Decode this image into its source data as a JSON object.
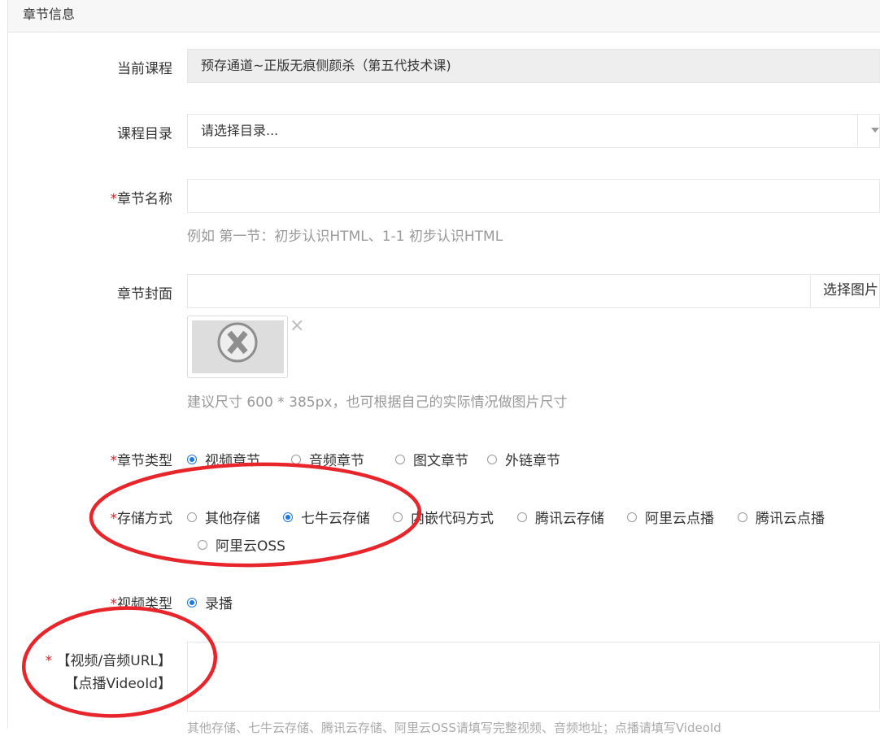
{
  "panel": {
    "title": "章节信息"
  },
  "form": {
    "current_course": {
      "label": "当前课程",
      "value": "预存通道~正版无痕侧颜杀（第五代技术课)"
    },
    "catalog": {
      "label": "课程目录",
      "value": "请选择目录..."
    },
    "chapter_name": {
      "required": "*",
      "label": "章节名称",
      "value": "",
      "help": "例如 第一节：初步认识HTML、1-1 初步认识HTML"
    },
    "cover": {
      "label": "章节封面",
      "value": "",
      "button": "选择图片",
      "remove": "×",
      "help": "建议尺寸 600 * 385px，也可根据自己的实际情况做图片尺寸"
    },
    "chapter_type": {
      "required": "*",
      "label": "章节类型",
      "options": [
        "视频章节",
        "音频章节",
        "图文章节",
        "外链章节"
      ],
      "selected": "视频章节"
    },
    "storage": {
      "required": "*",
      "label": "存储方式",
      "options": [
        "其他存储",
        "七牛云存储",
        "内嵌代码方式",
        "腾讯云存储",
        "阿里云点播",
        "腾讯云点播",
        "阿里云OSS"
      ],
      "selected": "七牛云存储"
    },
    "video_type": {
      "required": "*",
      "label": "视频类型",
      "options": [
        "录播"
      ],
      "selected": "录播"
    },
    "video_url": {
      "required": "*",
      "label_line1": "【视频/音频URL】",
      "label_line2": "【点播VideoId】",
      "value": "",
      "help": "其他存储、七牛云存储、腾讯云存储、阿里云OSS请填写完整视频、音频地址；点播请填写VideoId"
    }
  },
  "colors": {
    "accent": "#1e77e6",
    "required": "#e02020",
    "annotation": "#e8252b"
  }
}
